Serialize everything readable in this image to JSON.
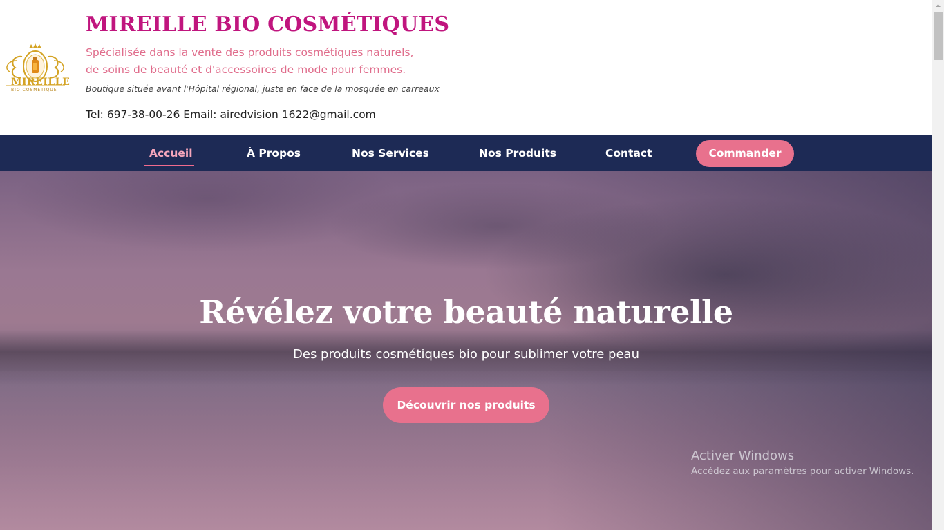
{
  "header": {
    "logo_text": "MIREILLE",
    "logo_subtext": "BIO COSMETIQUE",
    "title": "MIREILLE BIO COSMÉTIQUES",
    "description_line1": "Spécialisée dans la vente des produits cosmétiques naturels,",
    "description_line2": "de soins de beauté et d'accessoires de mode pour femmes.",
    "address": "Boutique située avant l'Hôpital régional, juste en face de la mosquée en carreaux",
    "contact": "Tel: 697-38-00-26 Email: airedvision 1622@gmail.com"
  },
  "nav": {
    "items": [
      {
        "label": "Accueil"
      },
      {
        "label": "À Propos"
      },
      {
        "label": "Nos Services"
      },
      {
        "label": "Nos Produits"
      },
      {
        "label": "Contact"
      }
    ],
    "cta_label": "Commander"
  },
  "hero": {
    "title": "Révélez votre beauté naturelle",
    "subtitle": "Des produits cosmétiques bio pour sublimer votre peau",
    "cta_label": "Découvrir nos produits"
  },
  "windows_watermark": {
    "line1": "Activer Windows",
    "line2": "Accédez aux paramètres pour activer Windows."
  },
  "colors": {
    "brand_title": "#c0157e",
    "brand_pink": "#e8718d",
    "nav_bg": "#1d2a55",
    "nav_active": "#f6a7bc"
  }
}
